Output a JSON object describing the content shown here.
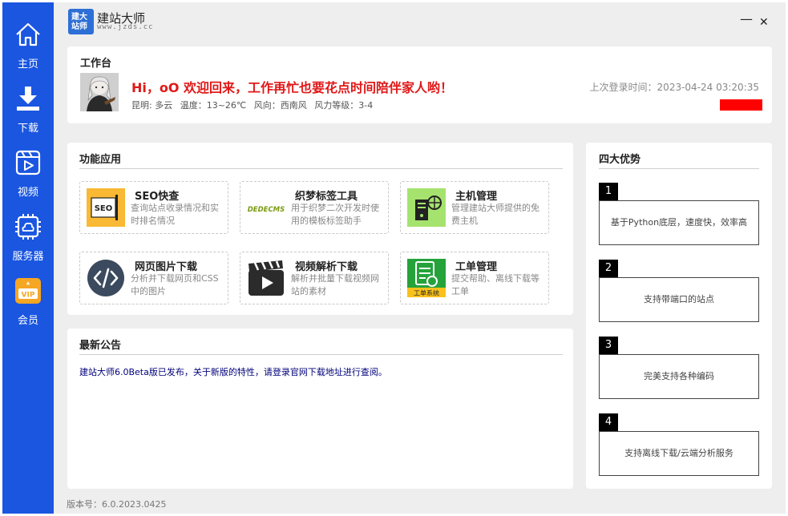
{
  "sidebar": {
    "items": [
      {
        "label": "主页",
        "icon": "home-icon"
      },
      {
        "label": "下载",
        "icon": "download-icon"
      },
      {
        "label": "视频",
        "icon": "video-icon"
      },
      {
        "label": "服务器",
        "icon": "server-icon"
      },
      {
        "label": "会员",
        "icon": "vip-icon"
      }
    ]
  },
  "header": {
    "logo_text": [
      "建大",
      "站师"
    ],
    "title": "建站大师",
    "url": "www.jzds.cc",
    "minimize": "—",
    "close": "✕"
  },
  "workbench": {
    "title": "工作台",
    "welcome": "Hi，oO  欢迎回来，工作再忙也要花点时间陪伴家人哟！",
    "weather": {
      "city": "昆明: 多云",
      "temp": "温度：13~26℃",
      "wind_dir": "风向：西南风",
      "wind_level": "风力等级：3-4"
    },
    "last_login": "上次登录时间：2023-04-24 03:20:35"
  },
  "features": {
    "title": "功能应用",
    "tiles": [
      {
        "name": "SEO快查",
        "desc": "查询站点收录情况和实时排名情况",
        "icon_text": "SEO"
      },
      {
        "name": "织梦标签工具",
        "desc": "用于织梦二次开发时使用的模板标签助手",
        "icon_text": "DEDECMS"
      },
      {
        "name": "主机管理",
        "desc": "管理建站大师提供的免费主机",
        "icon_text": ""
      },
      {
        "name": "网页图片下载",
        "desc": "分析并下载网页和CSS中的图片",
        "icon_text": "</>"
      },
      {
        "name": "视频解析下载",
        "desc": "解析并批量下载视频网站的素材",
        "icon_text": ""
      },
      {
        "name": "工单管理",
        "desc": "提交帮助、离线下载等工单",
        "icon_text": "工单系统"
      }
    ]
  },
  "notice": {
    "title": "最新公告",
    "text": "建站大师6.0Beta版已发布，关于新版的特性，请登录官网下载地址进行查阅。"
  },
  "advantages": {
    "title": "四大优势",
    "items": [
      {
        "num": "1",
        "text": "基于Python底层，速度快，效率高"
      },
      {
        "num": "2",
        "text": "支持带端口的站点"
      },
      {
        "num": "3",
        "text": "完美支持各种编码"
      },
      {
        "num": "4",
        "text": "支持离线下载/云端分析服务"
      }
    ]
  },
  "footer": {
    "version": "版本号：6.0.2023.0425"
  },
  "colors": {
    "sidebar": "#1a56e0",
    "welcome": "#e01818",
    "notice_text": "#00007a"
  }
}
